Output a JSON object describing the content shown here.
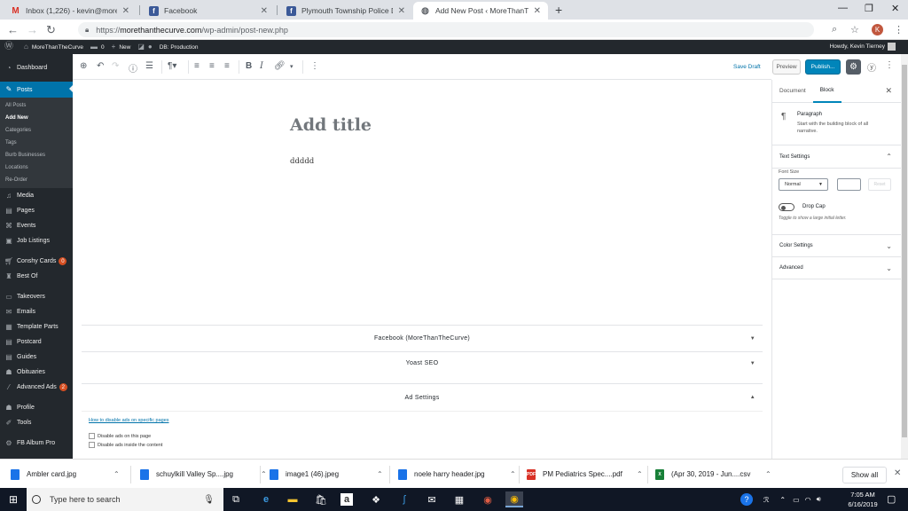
{
  "browser": {
    "tabs": [
      {
        "title": "Inbox (1,226) - kevin@morethan",
        "favicon": "gmail-icon",
        "color": "#d93025",
        "glyph": "M"
      },
      {
        "title": "Facebook",
        "favicon": "facebook-icon",
        "color": "#3b5998",
        "glyph": "f"
      },
      {
        "title": "Plymouth Township Police Depar",
        "favicon": "facebook-icon",
        "color": "#3b5998",
        "glyph": "f"
      },
      {
        "title": "Add New Post ‹ MoreThanTheCu",
        "favicon": "globe-icon",
        "color": "#5f6368",
        "glyph": "◍"
      }
    ],
    "url_prefix": "https://",
    "url_host": "morethanthecurve.com",
    "url_path": "/wp-admin/post-new.php",
    "avatar_letter": "K"
  },
  "adminbar": {
    "site": "MoreThanTheCurve",
    "comments": "0",
    "new": "New",
    "db": "DB: Production",
    "howdy": "Howdy, Kevin Tierney"
  },
  "sidebar": {
    "dashboard": "Dashboard",
    "posts": "Posts",
    "posts_sub": [
      "All Posts",
      "Add New",
      "Categories",
      "Tags",
      "Burb Businesses",
      "Locations",
      "Re-Order"
    ],
    "items_a": [
      {
        "label": "Media",
        "icon": "media-icon",
        "glyph": "♫"
      },
      {
        "label": "Pages",
        "icon": "pages-icon",
        "glyph": "▤"
      },
      {
        "label": "Events",
        "icon": "events-icon",
        "glyph": "⌘"
      },
      {
        "label": "Job Listings",
        "icon": "briefcase-icon",
        "glyph": "▣"
      }
    ],
    "conshy": "Conshy Cards",
    "conshy_badge": "0",
    "bestof": "Best Of",
    "items_b": [
      {
        "label": "Takeovers",
        "icon": "takeover-icon",
        "glyph": "▭"
      },
      {
        "label": "Emails",
        "icon": "email-icon",
        "glyph": "✉"
      },
      {
        "label": "Template Parts",
        "icon": "template-icon",
        "glyph": "▦"
      },
      {
        "label": "Postcard",
        "icon": "postcard-icon",
        "glyph": "▤"
      },
      {
        "label": "Guides",
        "icon": "guides-icon",
        "glyph": "▤"
      },
      {
        "label": "Obituaries",
        "icon": "obituaries-icon",
        "glyph": "☗"
      }
    ],
    "ads": "Advanced Ads",
    "ads_badge": "2",
    "profile": "Profile",
    "tools": "Tools",
    "fbalbum": "FB Album Pro"
  },
  "editor": {
    "save_draft": "Save Draft",
    "preview": "Preview",
    "publish": "Publish...",
    "title_placeholder": "Add title",
    "body_text": "ddddd",
    "metaboxes": [
      "Facebook (MoreThanTheCurve)",
      "Yoast SEO",
      "Ad Settings"
    ],
    "ad_link": "How to disable ads on specific pages",
    "ad_checks": [
      "Disable ads on this page",
      "Disable ads inside the content"
    ]
  },
  "inspector": {
    "tab_document": "Document",
    "tab_block": "Block",
    "block_name": "Paragraph",
    "block_desc": "Start with the building block of all narrative.",
    "text_settings": "Text Settings",
    "font_size_label": "Font Size",
    "font_size_value": "Normal",
    "reset": "Reset",
    "drop_cap": "Drop Cap",
    "drop_cap_help": "Toggle to show a large initial letter.",
    "color_settings": "Color Settings",
    "advanced": "Advanced"
  },
  "downloads": {
    "items": [
      {
        "name": "Ambler card.jpg",
        "icon": "image-file-icon",
        "color": "#1a73e8",
        "glyph": ""
      },
      {
        "name": "schuylkill Valley Sp....jpg",
        "icon": "image-file-icon",
        "color": "#1a73e8",
        "glyph": ""
      },
      {
        "name": "image1 (46).jpeg",
        "icon": "image-file-icon",
        "color": "#1a73e8",
        "glyph": ""
      },
      {
        "name": "noele harry header.jpg",
        "icon": "image-file-icon",
        "color": "#1a73e8",
        "glyph": ""
      },
      {
        "name": "PM Pediatrics Spec....pdf",
        "icon": "pdf-file-icon",
        "color": "#d93025",
        "glyph": "PDF"
      },
      {
        "name": "(Apr 30, 2019 - Jun....csv",
        "icon": "csv-file-icon",
        "color": "#188038",
        "glyph": "X"
      }
    ],
    "show_all": "Show all"
  },
  "taskbar": {
    "search_placeholder": "Type here to search",
    "time": "7:05 AM",
    "date": "6/16/2019"
  }
}
